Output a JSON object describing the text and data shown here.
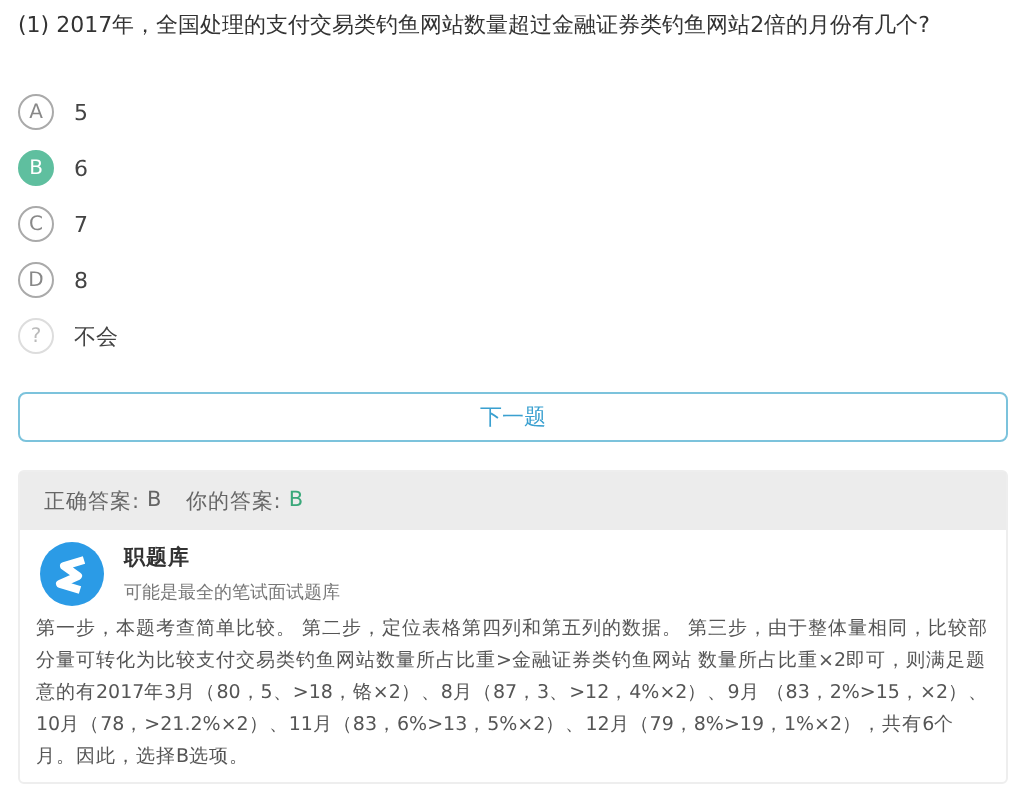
{
  "question": "(1) 2017年，全国处理的支付交易类钓鱼网站数量超过金融证券类钓鱼网站2倍的月份有几个?",
  "options": [
    {
      "kind": "choice",
      "letter": "A",
      "text": "5",
      "selected": false
    },
    {
      "kind": "choice",
      "letter": "B",
      "text": "6",
      "selected": true
    },
    {
      "kind": "choice",
      "letter": "C",
      "text": "7",
      "selected": false
    },
    {
      "kind": "choice",
      "letter": "D",
      "text": "8",
      "selected": false
    },
    {
      "kind": "unsure",
      "letter": "?",
      "text": "不会",
      "selected": false
    }
  ],
  "next_button": "下一题",
  "answer": {
    "correct_label": "正确答案:",
    "correct_value": "B",
    "yours_label": "你的答案:",
    "your_value": "B"
  },
  "source": {
    "name": "职题库",
    "tagline": "可能是最全的笔试面试题库"
  },
  "explanation": "第一步，本题考查简单比较。 第二步，定位表格第四列和第五列的数据。 第三步，由于整体量相同，比较部分量可转化为比较支付交易类钓鱼网站数量所占比重>金融证券类钓鱼网站 数量所占比重×2即可，则满足题意的有2017年3月（80，5、>18，铬×2）、8月（87，3、>12，4%×2）、9月 （83，2%>15，×2）、10月（78，>21.2%×2）、11月（83，6%>13，5%×2）、12月（79，8%>19，1%×2），共有6个月。因此，选择B选项。"
}
